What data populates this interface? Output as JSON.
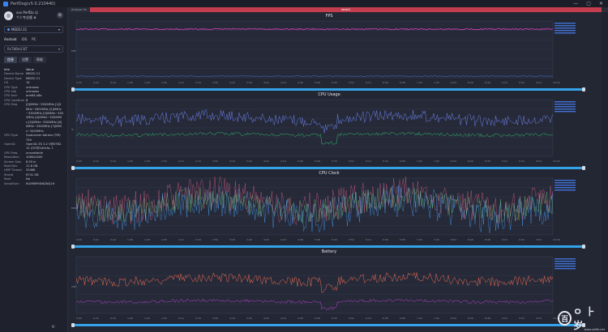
{
  "window": {
    "title": "PerfDog(v5.0.210440)",
    "controls": [
      "—",
      "▢",
      "✕"
    ]
  },
  "user": {
    "name": "xxx PerfDo ☺",
    "plan": "个人专业版 ♛"
  },
  "device": {
    "name": "MEIZU 21",
    "chevron": "▾"
  },
  "mode_tabs": [
    {
      "label": "Android"
    },
    {
      "label": "iOS"
    },
    {
      "label": "PC"
    }
  ],
  "app_select": {
    "label": "RxTbBnU3LT",
    "chevron": "▾"
  },
  "sub_tabs": [
    {
      "label": "信息"
    },
    {
      "label": "设置"
    },
    {
      "label": "帮助"
    }
  ],
  "info": {
    "header": {
      "k": "Info",
      "v": "Value"
    },
    "rows": [
      {
        "k": "Device Name",
        "v": "MEIZU 21"
      },
      {
        "k": "Device Type",
        "v": "MEIZU 21"
      },
      {
        "k": "OS",
        "v": "14"
      },
      {
        "k": "CPU Type",
        "v": "unknown"
      },
      {
        "k": "CPU Info",
        "v": "unknown"
      },
      {
        "k": "CPU Arch",
        "v": "arm64-v8a"
      },
      {
        "k": "CPU CoreNum",
        "v": "8"
      },
      {
        "k": "CPU Freq",
        "v": "[0]0MHz~3302MHz [1]0MHz~3302MHz [2]0MHz~3302MHz [3]0MHz~3302MHz [4]0MHz~3302MHz [5]0MHz~3302MHz [6]0MHz~3302MHz [7]0MHz~3302MHz"
      },
      {
        "k": "GPU Type",
        "v": "Qualcomm Adreno (TM) 750"
      },
      {
        "k": "OpenGL",
        "v": "OpenGL ES 3.2 V@0762.12 (GIT@1d0cfa, 1"
      },
      {
        "k": "GPU Freq",
        "v": "unavailable"
      },
      {
        "k": "Resolution",
        "v": "1080x2400"
      },
      {
        "k": "Screen Size",
        "v": "6.55 in"
      },
      {
        "k": "Root Dev",
        "v": "11.8 GB"
      },
      {
        "k": "UMP Thread",
        "v": "25468"
      },
      {
        "k": "Shield",
        "v": "6741 GB"
      },
      {
        "k": "Root",
        "v": "No"
      },
      {
        "k": "SerialNum",
        "v": "M1IRMFRKWZNQ1H"
      }
    ]
  },
  "sidebar_bottom_icon": "⚙",
  "top_strip": {
    "left_tag": "Analyze On",
    "session": "label1"
  },
  "charts": [
    {
      "title": "FPS",
      "ylabel": "FPS",
      "line_color": "#e040c8",
      "secondary_color": "#4a86ff"
    },
    {
      "title": "CPU Usage",
      "ylabel": "%",
      "line_color": "#6b7fe8",
      "secondary_color": "#2fbf6f"
    },
    {
      "title": "CPU Clock",
      "ylabel": "MHz",
      "line_color": "#e0608a",
      "secondary_color": "#4aa3ff"
    },
    {
      "title": "Battery",
      "ylabel": "mW",
      "line_color": "#ef6b55",
      "secondary_color": "#c042d8"
    }
  ],
  "time_ticks": [
    "0:00",
    "0:22",
    "0:44",
    "1:06",
    "1:28",
    "1:50",
    "2:12",
    "2:34",
    "2:56",
    "3:18",
    "3:40",
    "4:02",
    "4:24",
    "4:46",
    "5:08",
    "5:30",
    "5:52",
    "6:14",
    "6:36",
    "6:58",
    "7:20",
    "7:42",
    "8:04",
    "8:26",
    "8:48",
    "9:10",
    "9:32",
    "9:54",
    "10:16"
  ],
  "watermark": {
    "glyph": "百",
    "text": "ㅇ ⺊ 岁",
    "url": "www.ssfife.net"
  }
}
